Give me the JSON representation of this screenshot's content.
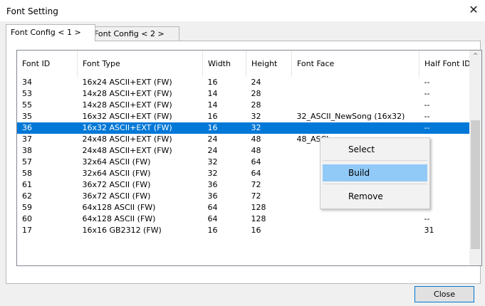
{
  "window": {
    "title": "Font Setting",
    "close_glyph": "✕"
  },
  "tabs": [
    {
      "label": "Font Config < 1 >"
    },
    {
      "label": "Font Config < 2 >"
    }
  ],
  "table": {
    "columns": [
      "Font ID",
      "Font Type",
      "Width",
      "Height",
      "Font Face",
      "Half Font ID"
    ],
    "rows": [
      [
        "34",
        "16x24 ASCII+EXT (FW)",
        "16",
        "24",
        "",
        "--"
      ],
      [
        "53",
        "14x28 ASCII+EXT (FW)",
        "14",
        "28",
        "",
        "--"
      ],
      [
        "55",
        "14x28 ASCII+EXT (FW)",
        "14",
        "28",
        "",
        "--"
      ],
      [
        "35",
        "16x32 ASCII+EXT (FW)",
        "16",
        "32",
        "32_ASCII_NewSong (16x32)",
        "--"
      ],
      [
        "36",
        "16x32 ASCII+EXT (FW)",
        "16",
        "32",
        "",
        "--"
      ],
      [
        "37",
        "24x48 ASCII+EXT (FW)",
        "24",
        "48",
        "48_ASCI",
        ""
      ],
      [
        "38",
        "24x48 ASCII+EXT (FW)",
        "24",
        "48",
        "",
        ""
      ],
      [
        "57",
        "32x64 ASCII (FW)",
        "32",
        "64",
        "",
        ""
      ],
      [
        "58",
        "32x64 ASCII (FW)",
        "32",
        "64",
        "",
        ""
      ],
      [
        "61",
        "36x72 ASCII (FW)",
        "36",
        "72",
        "",
        ""
      ],
      [
        "62",
        "36x72 ASCII (FW)",
        "36",
        "72",
        "",
        "--"
      ],
      [
        "59",
        "64x128 ASCII (FW)",
        "64",
        "128",
        "",
        "--"
      ],
      [
        "60",
        "64x128 ASCII (FW)",
        "64",
        "128",
        "",
        "--"
      ],
      [
        "17",
        "16x16 GB2312 (FW)",
        "16",
        "16",
        "",
        "31"
      ]
    ],
    "selected_row_index": 4
  },
  "context_menu": {
    "items": [
      {
        "label": "Select"
      },
      {
        "label": "Build"
      },
      {
        "label": "Remove"
      }
    ]
  },
  "scrollbar": {
    "up_glyph": "^"
  },
  "footer": {
    "close_label": "Close"
  },
  "colors": {
    "selection": "#0078d7",
    "menu_hover": "#91c9f7"
  }
}
